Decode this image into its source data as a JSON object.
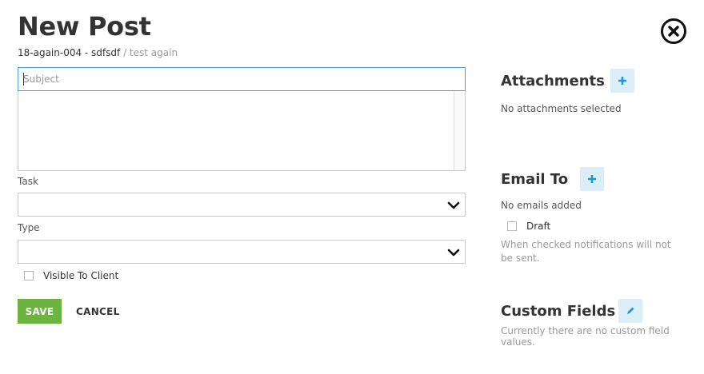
{
  "page": {
    "title": "New Post",
    "project": "18-again-004 - sdfsdf",
    "separator": " / ",
    "subproject": "test again"
  },
  "form": {
    "subject_placeholder": "Subject",
    "task_label": "Task",
    "task_value": "",
    "type_label": "Type",
    "type_value": "",
    "visible_to_client_label": "Visible To Client",
    "save_label": "SAVE",
    "cancel_label": "CANCEL"
  },
  "attachments": {
    "title": "Attachments",
    "empty_text": "No attachments selected"
  },
  "email": {
    "title": "Email To",
    "empty_text": "No emails added",
    "draft_label": "Draft",
    "draft_note": "When checked notifications will not be sent."
  },
  "custom_fields": {
    "title": "Custom Fields",
    "empty_text": "Currently there are no custom field values."
  },
  "icons": {
    "close": "close-circle-icon",
    "add": "plus-icon",
    "edit": "pencil-icon",
    "dropdown": "chevron-down-icon"
  },
  "colors": {
    "save": "#6cb33f",
    "accent": "#1a9ad6",
    "icon_button_bg": "#dbeef8",
    "focus_border": "#4aa3c8"
  }
}
